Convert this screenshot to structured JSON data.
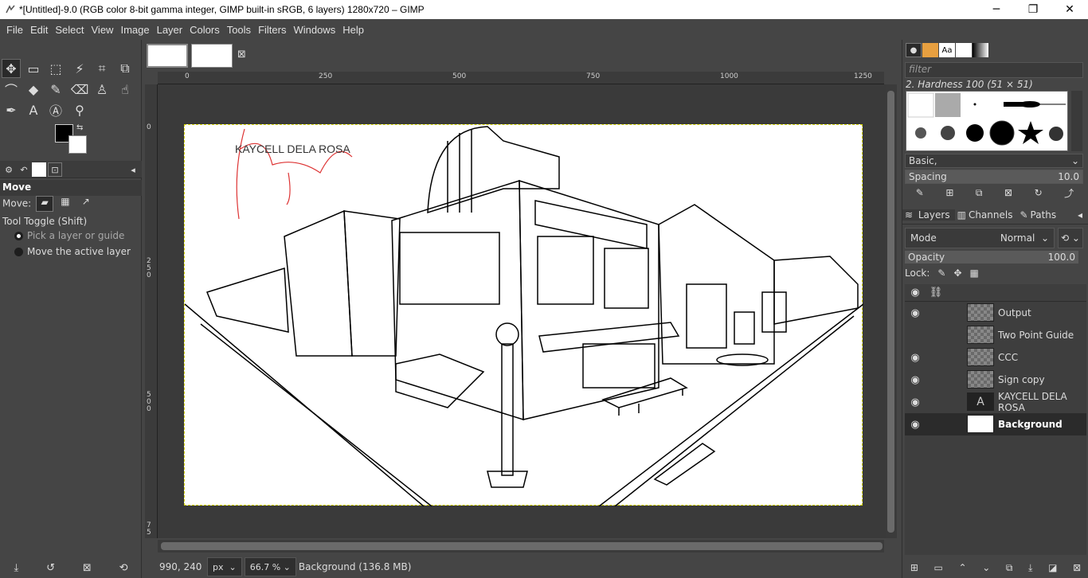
{
  "window": {
    "title": "*[Untitled]-9.0 (RGB color 8-bit gamma integer, GIMP built-in sRGB, 6 layers) 1280x720 – GIMP",
    "controls": [
      "─",
      "❐",
      "✕"
    ]
  },
  "menu": [
    "File",
    "Edit",
    "Select",
    "View",
    "Image",
    "Layer",
    "Colors",
    "Tools",
    "Filters",
    "Windows",
    "Help"
  ],
  "tool_options": {
    "title": "Move",
    "move_label": "Move:",
    "toggle_label": "Tool Toggle  (Shift)",
    "option1": "Pick a layer or guide",
    "option2": "Move the active layer"
  },
  "rulers": {
    "h": [
      "0",
      "250",
      "500",
      "750",
      "1000",
      "1250"
    ],
    "v": [
      "0",
      "250",
      "500",
      "75"
    ]
  },
  "canvas_text": "KAYCELL DELA ROSA",
  "status": {
    "coords": "990, 240",
    "unit": "px",
    "zoom": "66.7 %",
    "info": "Background (136.8 MB)"
  },
  "brushes": {
    "filter_placeholder": "filter",
    "selected": "2. Hardness 100 (51 × 51)",
    "preset": "Basic,",
    "spacing_label": "Spacing",
    "spacing_value": "10.0"
  },
  "layers_panel": {
    "tabs": [
      "Layers",
      "Channels",
      "Paths"
    ],
    "mode_label": "Mode",
    "mode_value": "Normal",
    "opacity_label": "Opacity",
    "opacity_value": "100.0",
    "lock_label": "Lock:",
    "layers": [
      {
        "name": "Output",
        "visible": true
      },
      {
        "name": "Two Point Guide",
        "visible": false
      },
      {
        "name": "CCC",
        "visible": true
      },
      {
        "name": "Sign copy",
        "visible": true
      },
      {
        "name": "KAYCELL DELA ROSA",
        "visible": true
      },
      {
        "name": "Background",
        "visible": true
      }
    ]
  }
}
